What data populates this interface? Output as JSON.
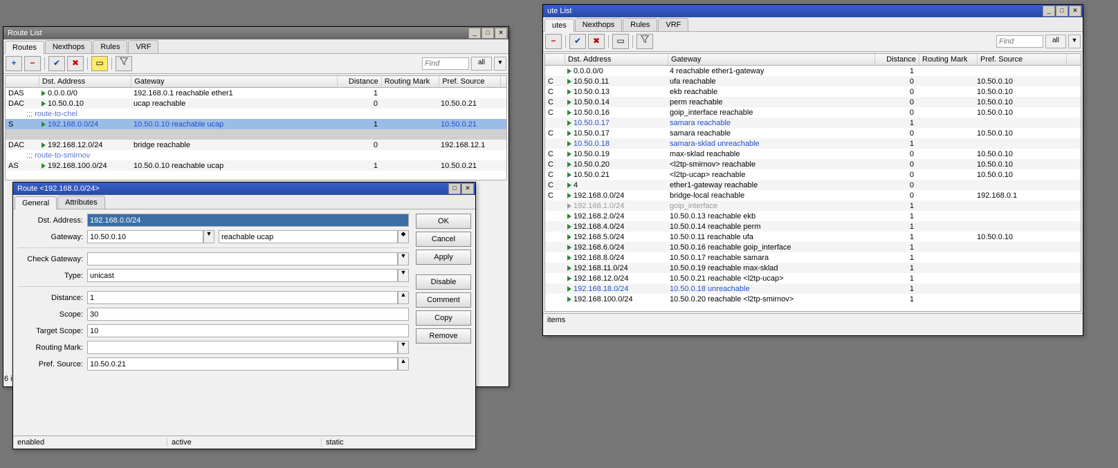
{
  "window_left": {
    "title": "Route List",
    "tabs": [
      "Routes",
      "Nexthops",
      "Rules",
      "VRF"
    ],
    "active_tab_index": 0,
    "find_placeholder": "Find",
    "all_label": "all",
    "columns": {
      "flags": "",
      "dst": "Dst. Address",
      "gateway": "Gateway",
      "distance": "Distance",
      "routing_mark": "Routing Mark",
      "pref_source": "Pref. Source"
    },
    "rows": [
      {
        "type": "data",
        "flags": "DAS",
        "dst": "0.0.0.0/0",
        "gateway": "192.168.0.1 reachable ether1",
        "distance": "1",
        "routing_mark": "",
        "pref_source": ""
      },
      {
        "type": "data",
        "flags": "DAC",
        "dst": "10.50.0.10",
        "gateway": "ucap reachable",
        "distance": "0",
        "routing_mark": "",
        "pref_source": "10.50.0.21"
      },
      {
        "type": "comment",
        "text": ";;; route-to-chel"
      },
      {
        "type": "data",
        "flags": "S",
        "dst": "192.168.0.0/24",
        "gateway": "10.50.0.10 reachable ucap",
        "distance": "1",
        "routing_mark": "",
        "pref_source": "10.50.0.21",
        "selected": true,
        "blue": true
      },
      {
        "type": "data",
        "flags": "",
        "dst": "",
        "gateway": "",
        "distance": "",
        "routing_mark": "",
        "pref_source": "",
        "sel2": true
      },
      {
        "type": "data",
        "flags": "DAC",
        "dst": "192.168.12.0/24",
        "gateway": "bridge reachable",
        "distance": "0",
        "routing_mark": "",
        "pref_source": "192.168.12.1"
      },
      {
        "type": "comment",
        "text": ";;; route-to-smirnov"
      },
      {
        "type": "data",
        "flags": "AS",
        "dst": "192.168.100.0/24",
        "gateway": "10.50.0.10 reachable ucap",
        "distance": "1",
        "routing_mark": "",
        "pref_source": "10.50.0.21"
      }
    ],
    "status_prefix": "6 i"
  },
  "dialog": {
    "title": "Route <192.168.0.0/24>",
    "tabs": [
      "General",
      "Attributes"
    ],
    "active_tab_index": 0,
    "buttons": [
      "OK",
      "Cancel",
      "Apply",
      "Disable",
      "Comment",
      "Copy",
      "Remove"
    ],
    "fields": {
      "dst_label": "Dst. Address:",
      "dst_value": "192.168.0.0/24",
      "gateway_label": "Gateway:",
      "gateway_value": "10.50.0.10",
      "gateway_status": "reachable ucap",
      "check_gw_label": "Check Gateway:",
      "check_gw_value": "",
      "type_label": "Type:",
      "type_value": "unicast",
      "distance_label": "Distance:",
      "distance_value": "1",
      "scope_label": "Scope:",
      "scope_value": "30",
      "target_scope_label": "Target Scope:",
      "target_scope_value": "10",
      "routing_mark_label": "Routing Mark:",
      "routing_mark_value": "",
      "pref_source_label": "Pref. Source:",
      "pref_source_value": "10.50.0.21"
    },
    "status": [
      "enabled",
      "active",
      "static"
    ]
  },
  "window_right": {
    "title": "ute List",
    "tabs": [
      "utes",
      "Nexthops",
      "Rules",
      "VRF"
    ],
    "active_tab_index": 0,
    "find_placeholder": "Find",
    "all_label": "all",
    "columns": {
      "flags": "",
      "dst": "Dst. Address",
      "gateway": "Gateway",
      "distance": "Distance",
      "routing_mark": "Routing Mark",
      "pref_source": "Pref. Source"
    },
    "rows": [
      {
        "flags": "",
        "dst": "0.0.0.0/0",
        "gateway": "4 reachable ether1-gateway",
        "distance": "1",
        "pref_source": ""
      },
      {
        "flags": "C",
        "dst": "10.50.0.11",
        "gateway": "ufa reachable",
        "distance": "0",
        "pref_source": "10.50.0.10"
      },
      {
        "flags": "C",
        "dst": "10.50.0.13",
        "gateway": "ekb reachable",
        "distance": "0",
        "pref_source": "10.50.0.10"
      },
      {
        "flags": "C",
        "dst": "10.50.0.14",
        "gateway": "perm reachable",
        "distance": "0",
        "pref_source": "10.50.0.10"
      },
      {
        "flags": "C",
        "dst": "10.50.0.16",
        "gateway": "goip_interface reachable",
        "distance": "0",
        "pref_source": "10.50.0.10"
      },
      {
        "flags": "",
        "dst": "10.50.0.17",
        "gateway": "samara reachable",
        "distance": "1",
        "pref_source": "",
        "blue": true
      },
      {
        "flags": "C",
        "dst": "10.50.0.17",
        "gateway": "samara reachable",
        "distance": "0",
        "pref_source": "10.50.0.10"
      },
      {
        "flags": "",
        "dst": "10.50.0.18",
        "gateway": "samara-sklad unreachable",
        "distance": "1",
        "pref_source": "",
        "blue": true
      },
      {
        "flags": "C",
        "dst": "10.50.0.19",
        "gateway": "max-sklad reachable",
        "distance": "0",
        "pref_source": "10.50.0.10"
      },
      {
        "flags": "C",
        "dst": "10.50.0.20",
        "gateway": "<l2tp-smirnov> reachable",
        "distance": "0",
        "pref_source": "10.50.0.10"
      },
      {
        "flags": "C",
        "dst": "10.50.0.21",
        "gateway": "<l2tp-ucap> reachable",
        "distance": "0",
        "pref_source": "10.50.0.10"
      },
      {
        "flags": "C",
        "dst": "4",
        "gateway": "ether1-gateway reachable",
        "distance": "0",
        "pref_source": ""
      },
      {
        "flags": "C",
        "dst": "192.168.0.0/24",
        "gateway": "bridge-local reachable",
        "distance": "0",
        "pref_source": "192.168.0.1"
      },
      {
        "flags": "",
        "dst": "192.168.1.0/24",
        "gateway": "goip_interface",
        "distance": "1",
        "pref_source": "",
        "grey": true
      },
      {
        "flags": "",
        "dst": "192.168.2.0/24",
        "gateway": "10.50.0.13 reachable ekb",
        "distance": "1",
        "pref_source": ""
      },
      {
        "flags": "",
        "dst": "192.168.4.0/24",
        "gateway": "10.50.0.14 reachable perm",
        "distance": "1",
        "pref_source": ""
      },
      {
        "flags": "",
        "dst": "192.168.5.0/24",
        "gateway": "10.50.0.11 reachable ufa",
        "distance": "1",
        "pref_source": "10.50.0.10"
      },
      {
        "flags": "",
        "dst": "192.168.6.0/24",
        "gateway": "10.50.0.16 reachable goip_interface",
        "distance": "1",
        "pref_source": ""
      },
      {
        "flags": "",
        "dst": "192.168.8.0/24",
        "gateway": "10.50.0.17 reachable samara",
        "distance": "1",
        "pref_source": ""
      },
      {
        "flags": "",
        "dst": "192.168.11.0/24",
        "gateway": "10.50.0.19 reachable max-sklad",
        "distance": "1",
        "pref_source": ""
      },
      {
        "flags": "",
        "dst": "192.168.12.0/24",
        "gateway": "10.50.0.21 reachable <l2tp-ucap>",
        "distance": "1",
        "pref_source": ""
      },
      {
        "flags": "",
        "dst": "192.168.18.0/24",
        "gateway": "10.50.0.18 unreachable",
        "distance": "1",
        "pref_source": "",
        "blue": true
      },
      {
        "flags": "",
        "dst": "192.168.100.0/24",
        "gateway": "10.50.0.20 reachable <l2tp-smirnov>",
        "distance": "1",
        "pref_source": ""
      }
    ],
    "footer": "items"
  }
}
